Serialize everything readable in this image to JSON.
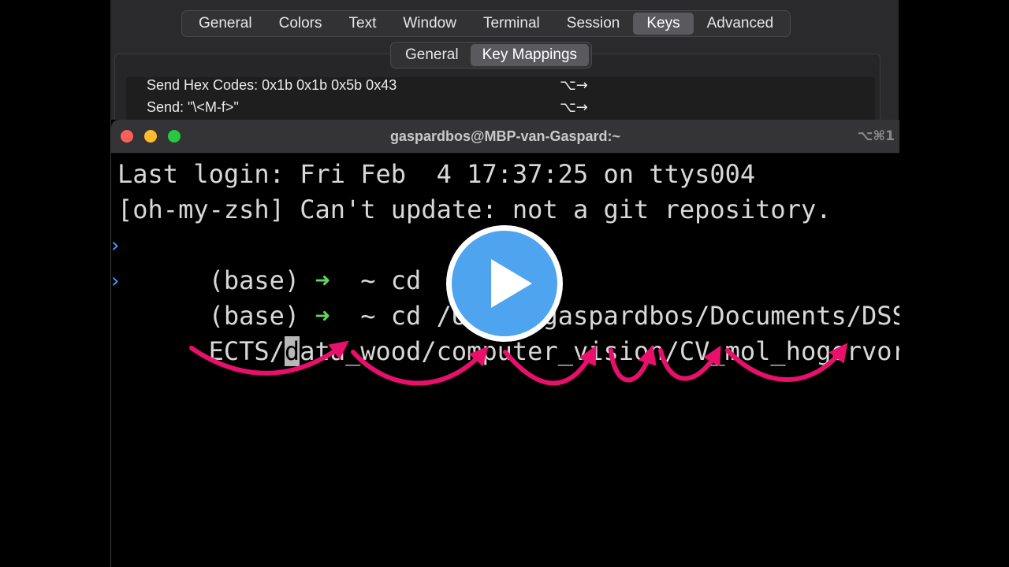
{
  "preferences": {
    "tabs": [
      {
        "label": "General"
      },
      {
        "label": "Colors"
      },
      {
        "label": "Text"
      },
      {
        "label": "Window"
      },
      {
        "label": "Terminal"
      },
      {
        "label": "Session"
      },
      {
        "label": "Keys",
        "active": true
      },
      {
        "label": "Advanced"
      }
    ],
    "subtabs": [
      {
        "label": "General"
      },
      {
        "label": "Key Mappings",
        "active": true
      }
    ],
    "mappings": [
      {
        "action": "Send Hex Codes: 0x1b 0x1b 0x5b 0x43",
        "combo": "⌥→"
      },
      {
        "action": "Send: \"\\<M-f>\"",
        "combo": "⌥→"
      }
    ]
  },
  "terminal": {
    "title": "gaspardbos@MBP-van-Gaspard:~",
    "shortcut": "⌥⌘1",
    "lines": [
      {
        "text": "Last login: Fri Feb  4 17:37:25 on ttys004"
      },
      {
        "text": "[oh-my-zsh] Can't update: not a git repository."
      },
      {
        "prefix": "(base) ",
        "arrow": "➜",
        "rest": "  ~ cd"
      },
      {
        "prefix": "(base) ",
        "arrow": "➜",
        "rest": "  ~ cd /Users/gaspardbos/Documents/DSS/PROJ"
      },
      {
        "before_cursor": "ECTS/",
        "cursor_char": "d",
        "after_cursor": "ata_wood/computer_vision/CV_mol_hogervorst"
      }
    ]
  },
  "colors": {
    "arrow_annotation": "#e8106a",
    "prompt_arrow": "#5fd75f",
    "play_button": "#4ea4ee"
  },
  "overlay": {
    "icon": "play-icon"
  }
}
